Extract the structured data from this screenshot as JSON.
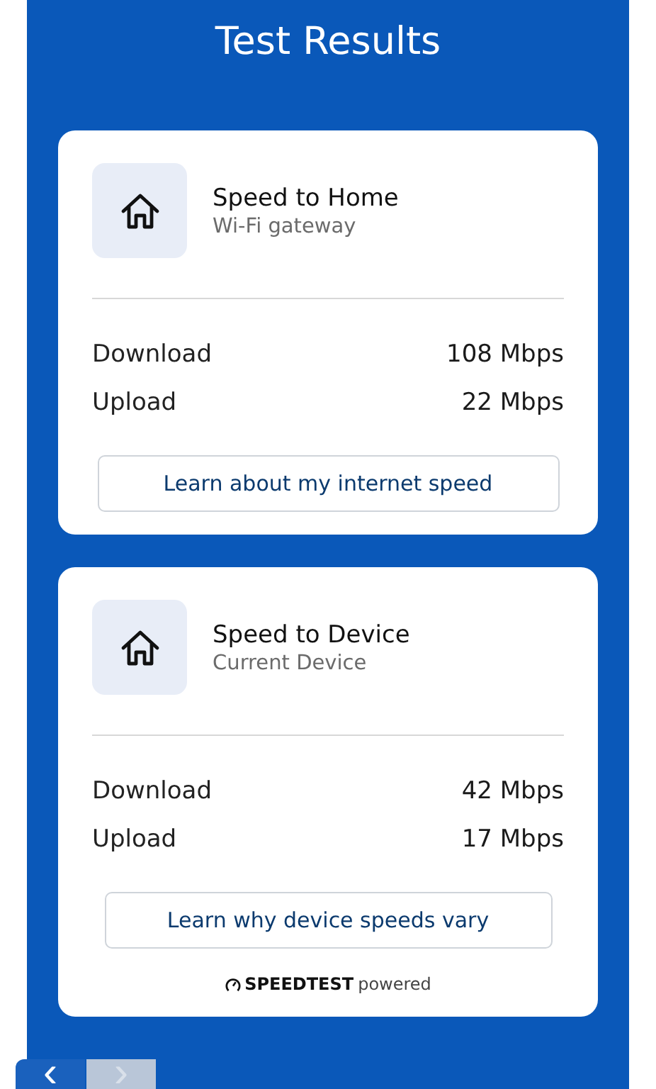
{
  "title": "Test Results",
  "cards": [
    {
      "title": "Speed to Home",
      "subtitle": "Wi-Fi gateway",
      "rows": [
        {
          "label": "Download",
          "value": "108 Mbps"
        },
        {
          "label": "Upload",
          "value": "22 Mbps"
        }
      ],
      "button": "Learn about my internet speed"
    },
    {
      "title": "Speed to Device",
      "subtitle": "Current Device",
      "rows": [
        {
          "label": "Download",
          "value": "42 Mbps"
        },
        {
          "label": "Upload",
          "value": "17 Mbps"
        }
      ],
      "button": "Learn why device speeds vary",
      "footer": {
        "brand": "SPEEDTEST",
        "suffix": "powered"
      }
    }
  ],
  "nav": [
    {
      "label": "‹",
      "disabled": false
    },
    {
      "label": "›",
      "disabled": true
    }
  ]
}
